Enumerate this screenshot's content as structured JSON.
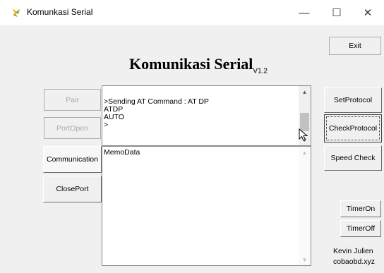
{
  "window": {
    "title": "Komunkasi Serial",
    "minimize_glyph": "—",
    "maximize_glyph": "☐",
    "close_glyph": "✕"
  },
  "heading": {
    "main": "Komunikasi Serial",
    "version": "V1.2"
  },
  "top_right": {
    "exit_label": "Exit"
  },
  "left_buttons": {
    "pair": "Pair",
    "port_open": "PortOpen",
    "communication": "Communication",
    "close_port": "ClosePort"
  },
  "right_buttons": {
    "set_protocol": "SetProtocol",
    "check_protocol": "CheckProtocol",
    "speed_check": "Speed Check",
    "timer_on": "TimerOn",
    "timer_off": "TimerOff"
  },
  "output_memo": {
    "lines": [
      ">Sending AT Command : AT DP",
      "ATDP",
      "AUTO",
      "",
      ">"
    ]
  },
  "data_memo": {
    "text": "MemoData"
  },
  "credit": {
    "name": "Kevin Julien",
    "site": "cobaobd.xyz"
  },
  "icons": {
    "app": "yellow-green-pinwheel-icon",
    "scroll_up": "arrow-up-icon",
    "scroll_down": "arrow-down-icon",
    "cursor": "mouse-pointer-icon"
  },
  "colors": {
    "window_bg": "#f0f0f0",
    "titlebar_bg": "#ffffff",
    "memo_bg": "#ffffff"
  }
}
